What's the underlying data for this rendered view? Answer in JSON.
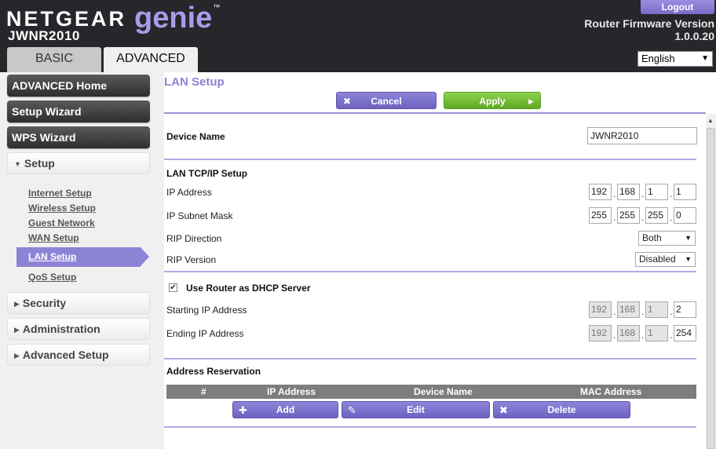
{
  "header": {
    "brand": "NETGEAR",
    "product": "genie",
    "trademark": "™",
    "model": "JWNR2010",
    "logout_label": "Logout",
    "firmware_label": "Router Firmware Version",
    "firmware_version": "1.0.0.20",
    "language": "English",
    "tabs": [
      "BASIC",
      "ADVANCED"
    ]
  },
  "sidebar": {
    "advanced_home": "ADVANCED Home",
    "setup_wizard": "Setup Wizard",
    "wps_wizard": "WPS Wizard",
    "setup": "Setup",
    "setup_items": [
      "Internet Setup",
      "Wireless Setup",
      "Guest Network",
      "WAN Setup",
      "LAN Setup",
      "QoS Setup"
    ],
    "security": "Security",
    "administration": "Administration",
    "advanced_setup": "Advanced Setup"
  },
  "main": {
    "title": "LAN Setup",
    "cancel_label": "Cancel",
    "apply_label": "Apply",
    "device_name_label": "Device Name",
    "device_name_value": "JWNR2010",
    "tcpip_heading": "LAN TCP/IP Setup",
    "ip_address_label": "IP Address",
    "ip_address": [
      "192",
      "168",
      "1",
      "1"
    ],
    "subnet_label": "IP Subnet Mask",
    "subnet": [
      "255",
      "255",
      "255",
      "0"
    ],
    "rip_direction_label": "RIP Direction",
    "rip_direction": "Both",
    "rip_version_label": "RIP Version",
    "rip_version": "Disabled",
    "dhcp_label": "Use Router as DHCP Server",
    "start_ip_label": "Starting IP Address",
    "start_ip": [
      "192",
      "168",
      "1",
      "2"
    ],
    "end_ip_label": "Ending IP Address",
    "end_ip": [
      "192",
      "168",
      "1",
      "254"
    ],
    "reservation_heading": "Address Reservation",
    "table_columns": [
      "#",
      "IP Address",
      "Device Name",
      "MAC Address"
    ],
    "add_label": "Add",
    "edit_label": "Edit",
    "delete_label": "Delete"
  }
}
